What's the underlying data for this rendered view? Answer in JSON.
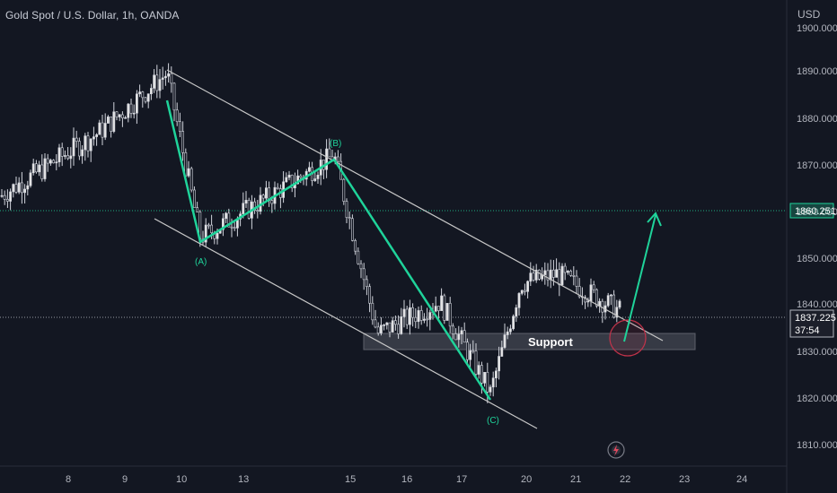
{
  "header": {
    "title": "Gold Spot / U.S. Dollar, 1h, OANDA",
    "currency": "USD"
  },
  "price_axis": {
    "current_price": "1837.225",
    "countdown": "37:54",
    "target_price": "1860.251"
  },
  "annotations": {
    "support_label": "Support",
    "wave_a": "(A)",
    "wave_b": "(B)",
    "wave_c": "(C)"
  },
  "colors": {
    "background": "#131722",
    "wave": "#1fd39a",
    "channel": "#c8c8c8",
    "support_zone": "#3a3d47",
    "target_line": "#1fd39a",
    "current_line": "#9598a1",
    "circle": "#c2334a"
  },
  "chart_data": {
    "type": "candlestick",
    "title": "Gold Spot / U.S. Dollar, 1h, OANDA",
    "y_unit": "USD",
    "ylim": [
      1803,
      1905
    ],
    "y_ticks": [
      "1810.000",
      "1820.000",
      "1830.000",
      "1840.000",
      "1850.000",
      "1860.000",
      "1870.000",
      "1880.000",
      "1890.000",
      "1900.000"
    ],
    "x_ticks": [
      "8",
      "9",
      "10",
      "13",
      "15",
      "16",
      "17",
      "20",
      "21",
      "22",
      "23",
      "24"
    ],
    "grid": false,
    "price_path": [
      {
        "x": "start",
        "y": 1862
      },
      {
        "x": "9",
        "y": 1876
      },
      {
        "x": "10",
        "y": 1889
      },
      {
        "x": "10",
        "y": 1853
      },
      {
        "x": "13",
        "y": 1862
      },
      {
        "x": "14",
        "y": 1871
      },
      {
        "x": "15",
        "y": 1832
      },
      {
        "x": "16",
        "y": 1839
      },
      {
        "x": "17",
        "y": 1819
      },
      {
        "x": "20",
        "y": 1843
      },
      {
        "x": "21",
        "y": 1845
      },
      {
        "x": "22",
        "y": 1837
      }
    ],
    "wave_points": [
      {
        "label": "start",
        "x": "10",
        "y": 1889
      },
      {
        "label": "(A)",
        "x": "10",
        "y": 1853
      },
      {
        "label": "(B)",
        "x": "14",
        "y": 1871
      },
      {
        "label": "(C)",
        "x": "17",
        "y": 1819
      }
    ],
    "support_zone": {
      "label": "Support",
      "y_low": 1830,
      "y_high": 1833
    },
    "current_price": 1837.225,
    "target_price": 1860.251,
    "projection": {
      "from": 1832,
      "to": 1860
    }
  }
}
